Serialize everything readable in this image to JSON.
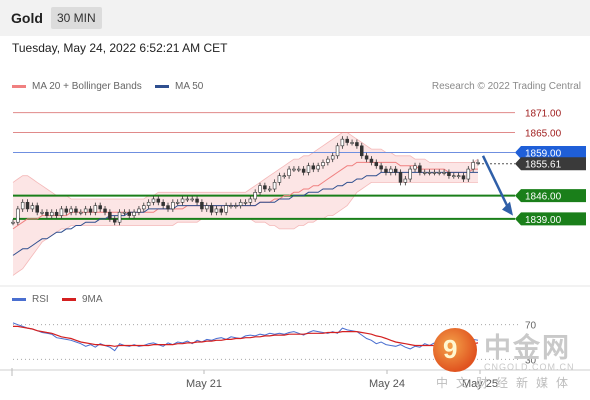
{
  "header": {
    "symbol": "Gold",
    "timeframe": "30 MIN"
  },
  "datetime": "Tuesday, May 24, 2022 6:52:21 AM CET",
  "legend": {
    "ma20_label": "MA 20 + Bollinger Bands",
    "ma50_label": "MA 50",
    "credit": "Research © 2022 Trading Central",
    "rsi_label": "RSI",
    "ma9_label": "9MA"
  },
  "colors": {
    "ma20": "#f08080",
    "bollinger_fill": "#fbe0e0",
    "ma50": "#2f4f8f",
    "resistance": "#e08a8a",
    "pivot": "#1f5fd8",
    "support": "#1a7f1a",
    "last_price_badge": "#3a3a3a",
    "rsi": "#4a6fd0",
    "rsi_ma": "#d42020",
    "arrow": "#2f5fa8"
  },
  "watermark": {
    "logo_char": "9",
    "title": "中金网",
    "domain": "CNGOLD.COM.CN",
    "slogan": "中文财经新媒体"
  },
  "chart_data": [
    {
      "type": "candlestick",
      "title": "Gold",
      "timeframe": "30 MIN",
      "x_tick_labels": [
        "May 21",
        "May 24",
        "May 25"
      ],
      "ylim": [
        1820,
        1876
      ],
      "levels": [
        {
          "label": "1871.00",
          "value": 1871.0,
          "kind": "resistance"
        },
        {
          "label": "1865.00",
          "value": 1865.0,
          "kind": "resistance"
        },
        {
          "label": "1859.00",
          "value": 1859.0,
          "kind": "pivot"
        },
        {
          "label": "1855.61",
          "value": 1855.61,
          "kind": "last"
        },
        {
          "label": "1846.00",
          "value": 1846.0,
          "kind": "support"
        },
        {
          "label": "1839.00",
          "value": 1839.0,
          "kind": "support"
        }
      ],
      "forecast_arrow": {
        "from": 1858.0,
        "to": 1840.0
      },
      "close": [
        1838,
        1842,
        1844,
        1842,
        1843,
        1841,
        1841,
        1840,
        1841,
        1840,
        1842,
        1841,
        1842,
        1841,
        1841,
        1842,
        1841,
        1843,
        1842,
        1841,
        1839,
        1838,
        1841,
        1841,
        1840,
        1841,
        1842,
        1843,
        1844,
        1845,
        1844,
        1843,
        1842,
        1844,
        1844,
        1845,
        1845,
        1845,
        1844,
        1842,
        1843,
        1841,
        1842,
        1841,
        1843,
        1843,
        1843,
        1844,
        1844,
        1845,
        1847,
        1849,
        1848,
        1848,
        1850,
        1852,
        1852,
        1854,
        1854,
        1854,
        1853,
        1855,
        1854,
        1855,
        1856,
        1857,
        1858,
        1861,
        1863,
        1862,
        1862,
        1861,
        1858,
        1857,
        1856,
        1855,
        1854,
        1853,
        1854,
        1853,
        1850,
        1851,
        1854,
        1855,
        1853,
        1853,
        1853,
        1853,
        1853,
        1853,
        1852,
        1852,
        1852,
        1851,
        1854,
        1856,
        1856
      ],
      "ma20": [
        1836,
        1837,
        1838,
        1839,
        1839,
        1839,
        1840,
        1840,
        1840,
        1840,
        1840,
        1840,
        1841,
        1841,
        1841,
        1841,
        1841,
        1841,
        1841,
        1841,
        1841,
        1841,
        1841,
        1841,
        1841,
        1841,
        1841,
        1841,
        1841,
        1841,
        1842,
        1842,
        1842,
        1842,
        1842,
        1842,
        1843,
        1843,
        1843,
        1843,
        1843,
        1843,
        1843,
        1843,
        1843,
        1843,
        1843,
        1843,
        1843,
        1843,
        1843,
        1844,
        1844,
        1844,
        1845,
        1845,
        1846,
        1846,
        1847,
        1847,
        1848,
        1848,
        1849,
        1849,
        1850,
        1851,
        1852,
        1853,
        1854,
        1855,
        1855,
        1856,
        1856,
        1856,
        1856,
        1856,
        1856,
        1856,
        1856,
        1856,
        1855,
        1855,
        1855,
        1855,
        1854,
        1854,
        1854,
        1854,
        1854,
        1854,
        1853,
        1853,
        1853,
        1853,
        1853,
        1854,
        1854
      ],
      "bb_upper": [
        1850,
        1851,
        1852,
        1852,
        1851,
        1850,
        1849,
        1848,
        1847,
        1846,
        1846,
        1846,
        1845,
        1845,
        1845,
        1845,
        1845,
        1845,
        1845,
        1845,
        1845,
        1845,
        1845,
        1845,
        1845,
        1845,
        1845,
        1845,
        1846,
        1846,
        1847,
        1847,
        1847,
        1847,
        1847,
        1847,
        1847,
        1847,
        1847,
        1847,
        1847,
        1847,
        1847,
        1847,
        1847,
        1847,
        1847,
        1847,
        1847,
        1848,
        1849,
        1850,
        1851,
        1852,
        1853,
        1854,
        1855,
        1856,
        1857,
        1857,
        1858,
        1858,
        1859,
        1860,
        1861,
        1862,
        1863,
        1864,
        1865,
        1865,
        1864,
        1863,
        1862,
        1861,
        1860,
        1860,
        1860,
        1859,
        1859,
        1858,
        1858,
        1858,
        1858,
        1857,
        1857,
        1857,
        1856,
        1856,
        1856,
        1856,
        1856,
        1856,
        1856,
        1856,
        1856,
        1856,
        1857
      ],
      "bb_lower": [
        1822,
        1823,
        1824,
        1826,
        1828,
        1830,
        1832,
        1833,
        1834,
        1835,
        1836,
        1836,
        1837,
        1837,
        1837,
        1837,
        1837,
        1837,
        1837,
        1837,
        1837,
        1837,
        1837,
        1837,
        1837,
        1837,
        1837,
        1837,
        1837,
        1837,
        1837,
        1837,
        1837,
        1837,
        1838,
        1838,
        1838,
        1838,
        1838,
        1839,
        1839,
        1839,
        1839,
        1839,
        1839,
        1839,
        1839,
        1839,
        1839,
        1839,
        1838,
        1838,
        1838,
        1837,
        1837,
        1836,
        1836,
        1836,
        1836,
        1837,
        1837,
        1838,
        1838,
        1839,
        1839,
        1840,
        1840,
        1841,
        1842,
        1843,
        1845,
        1847,
        1848,
        1849,
        1850,
        1850,
        1850,
        1850,
        1850,
        1850,
        1850,
        1850,
        1850,
        1850,
        1850,
        1850,
        1850,
        1850,
        1850,
        1850,
        1850,
        1850,
        1850,
        1850,
        1850,
        1850,
        1850
      ],
      "ma50": [
        1828,
        1829,
        1830,
        1830,
        1831,
        1832,
        1833,
        1833,
        1834,
        1835,
        1835,
        1836,
        1836,
        1837,
        1837,
        1838,
        1838,
        1838,
        1839,
        1839,
        1840,
        1840,
        1840,
        1840,
        1841,
        1841,
        1841,
        1841,
        1842,
        1842,
        1842,
        1842,
        1842,
        1842,
        1843,
        1843,
        1843,
        1843,
        1843,
        1843,
        1843,
        1843,
        1843,
        1843,
        1843,
        1843,
        1843,
        1843,
        1843,
        1843,
        1843,
        1844,
        1844,
        1844,
        1844,
        1845,
        1845,
        1845,
        1846,
        1846,
        1846,
        1847,
        1847,
        1847,
        1848,
        1848,
        1848,
        1849,
        1849,
        1850,
        1850,
        1851,
        1851,
        1852,
        1852,
        1852,
        1853,
        1853,
        1853,
        1853,
        1853,
        1853,
        1853,
        1853,
        1853,
        1853,
        1853,
        1853,
        1853,
        1853,
        1853,
        1853,
        1853,
        1853,
        1853,
        1853,
        1853
      ]
    },
    {
      "type": "line",
      "title": "RSI",
      "series_names": [
        "RSI",
        "9MA"
      ],
      "ylim": [
        20,
        80
      ],
      "y_tick_labels": [
        "70",
        "30"
      ],
      "rsi": [
        72,
        70,
        68,
        66,
        65,
        63,
        61,
        60,
        59,
        55,
        54,
        53,
        52,
        50,
        48,
        45,
        47,
        44,
        48,
        46,
        44,
        40,
        48,
        46,
        45,
        47,
        45,
        46,
        48,
        49,
        47,
        45,
        49,
        47,
        50,
        49,
        51,
        48,
        52,
        50,
        53,
        52,
        54,
        55,
        53,
        56,
        55,
        54,
        57,
        58,
        57,
        59,
        58,
        60,
        59,
        60,
        59,
        61,
        62,
        60,
        58,
        61,
        63,
        62,
        61,
        60,
        62,
        60,
        66,
        64,
        63,
        62,
        58,
        54,
        52,
        48,
        50,
        47,
        46,
        45,
        47,
        44,
        42,
        45,
        44,
        48,
        46,
        49,
        47,
        45,
        46,
        48,
        47,
        49,
        50,
        53,
        52
      ],
      "rsi_ma": [
        68,
        68,
        67,
        66,
        65,
        63,
        62,
        61,
        60,
        58,
        56,
        55,
        54,
        52,
        50,
        49,
        48,
        47,
        47,
        46,
        46,
        45,
        46,
        46,
        46,
        46,
        46,
        46,
        46,
        47,
        47,
        47,
        47,
        47,
        48,
        48,
        49,
        49,
        50,
        50,
        51,
        51,
        52,
        52,
        53,
        53,
        54,
        54,
        55,
        55,
        56,
        56,
        57,
        57,
        58,
        58,
        58,
        59,
        59,
        59,
        59,
        60,
        60,
        60,
        60,
        61,
        61,
        61,
        62,
        62,
        62,
        62,
        61,
        60,
        59,
        57,
        56,
        54,
        52,
        50,
        49,
        48,
        47,
        46,
        46,
        46,
        46,
        46,
        46,
        46,
        46,
        46,
        47,
        47,
        47,
        48,
        49
      ]
    }
  ]
}
